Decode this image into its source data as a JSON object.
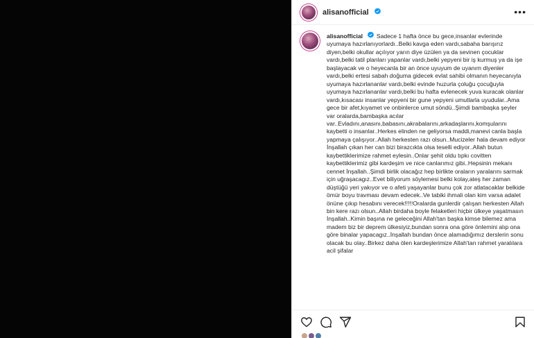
{
  "post": {
    "username": "alisanofficial",
    "caption": "Sadece 1 hafta önce bu gece,insanlar evlerinde uyumaya hazırlanıyorlardı..Belki kavga eden vardı,sabaha barışırız diyen,belki okullar açılıyor yarın diye üzülen ya da sevinen çocuklar vardı,belki tatil planları yapanlar vardı,belki yepyeni bir iş kurmuş ya da işe başlayacak ve o heyecanla bir an önce uyuyum de uyanım diyenler vardı,belki ertesi sabah doğuma gidecek evlat sahibi olmanın heyecanıyla uyumaya hazırlananlar vardı,belki evinde huzurla çoluğu çocuğuyla uyumaya hazırlananlar vardı,belki bu hafta evlenecek yuva kuracak olanlar vardı,kısacası insanlar yepyeni bir gune yepyeni umutlarla uyudular..Ama gece bir afet,kıyamet ve onbinlerce umut söndü..Şimdi bambaşka şeyler var oralarda,bambaşka acılar var..Evladını,anasını,babasını,akrabalarını,arkadaşlarını,komşularını kaybetti o insanlar..Herkes elinden ne geliyorsa maddi,manevi canla başla yapmaya çalışıyor..Allah herkesten razı olsun..Mucizeler hala devam ediyor İnşallah çıkan her can bizi birazcıkta olsa teselli ediyor..Allah butun kaybettiklerimize rahmet eylesin..Onlar şehit oldu tıpkı covitten kaybettiklerimiz gibi kardeşim ve nice canlarımız gibi..Hepsinin mekanı cennet İnşallah..Şimdi birlik olacağız hep birlikte oraların yaralarını sarmak için uğraşacagız..Evet biliyorum söylemesi belki kolay,ateş her zaman düştüğü yeri yakıyor ve o afeti yaşayanlar bunu çok zor atlatacaklar belkide ömür boyu travması devam edecek..Ve tabiki ihmali olan kim varsa adalet önüne çıkıp hesabını verecek!!!!!Oralarda gunlerdir çalışan herkesten Allah bin kere razı olsun..Allah birdaha boyle felaketleri hiçbir ülkeye yaşatmasın İnşallah..Kimin başına ne geleceğini Allah'tan başka kimse bilemez ama madem biz bir deprem ülkesiyiz,bundan sonra ona göre önlemini alıp ona göre binalar yapacagız..İnşallah bundan önce alamadığımız derslerin sonu olacak bu olay..Birkez daha ölen kardeşlerimize Allah'tan rahmet yaralılara acil şifalar"
  },
  "icons": {
    "verified": "verified-badge-icon",
    "more": "more-options-icon",
    "like": "heart-icon",
    "comment": "comment-icon",
    "share": "share-icon",
    "save": "bookmark-icon"
  },
  "colors": {
    "media_bg": "#050505",
    "verified_blue": "#0095f6",
    "text": "#262626"
  }
}
